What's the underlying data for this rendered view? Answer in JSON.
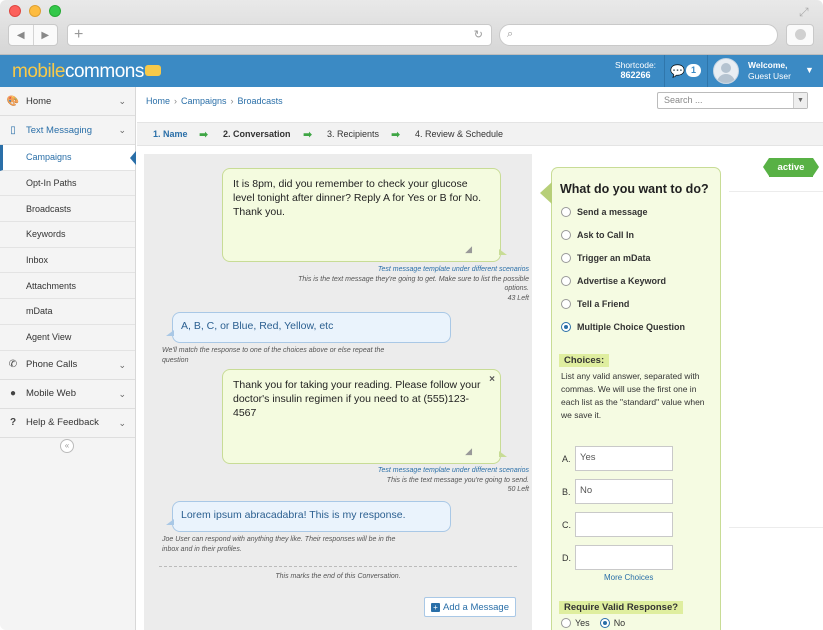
{
  "browser": {
    "back_icon": "◀",
    "forward_icon": "▶",
    "new_tab_icon": "+",
    "reload_icon": "↻",
    "search_icon": "⌕"
  },
  "header": {
    "logo_part1": "mobile",
    "logo_part2": "commons",
    "shortcode_label": "Shortcode:",
    "shortcode_value": "862266",
    "message_count": "1",
    "welcome_label": "Welcome,",
    "user_name": "Guest User",
    "colors": {
      "header_bg": "#3b8ac4",
      "logo_accent": "#f7c94a"
    }
  },
  "sidebar": {
    "items": [
      {
        "label": "Home",
        "icon": "palette-icon"
      },
      {
        "label": "Text Messaging",
        "icon": "phone-icon"
      },
      {
        "label": "Phone Calls",
        "icon": "phone-handset-icon"
      },
      {
        "label": "Mobile Web",
        "icon": "globe-icon"
      },
      {
        "label": "Help & Feedback",
        "icon": "question-icon"
      }
    ],
    "sub_items": [
      "Campaigns",
      "Opt-In Paths",
      "Broadcasts",
      "Keywords",
      "Inbox",
      "Attachments",
      "mData",
      "Agent View"
    ],
    "collapse_icon": "«"
  },
  "breadcrumb": {
    "items": [
      "Home",
      "Campaigns",
      "Broadcasts"
    ],
    "separator": "›"
  },
  "search": {
    "placeholder": "Search ..."
  },
  "wizard": {
    "steps": [
      "1. Name",
      "2. Conversation",
      "3. Recipients",
      "4. Review & Schedule"
    ],
    "arrow": "➡"
  },
  "conversation": {
    "message1": {
      "text": "It is 8pm, did you remember to check your glucose level tonight after dinner? Reply A for Yes or B for No. Thank you.",
      "link": "Test message template under different scenarios",
      "hint": "This is the text message they're going to get. Make sure to list the possible options.",
      "count": "43 Left"
    },
    "response1": {
      "text": "A, B, C, or Blue, Red, Yellow, etc",
      "hint": "We'll match the response to one of the choices above or else repeat the question"
    },
    "message2": {
      "text": "Thank you for taking your reading. Please follow your doctor's insulin regimen if you need to at (555)123-4567",
      "link": "Test message template under different scenarios",
      "hint": "This is the text message you're going to send.",
      "count": "50 Left",
      "close": "×"
    },
    "response2": {
      "text": "Lorem ipsum abracadabra! This is my response.",
      "hint": "Joe User can respond with anything they like. Their responses will be in the inbox and in their profiles."
    },
    "end_text": "This marks the end of this Conversation.",
    "add_button": "Add a Message"
  },
  "options": {
    "title": "What do you want to do?",
    "actions": [
      {
        "label": "Send a message",
        "selected": false
      },
      {
        "label": "Ask to Call In",
        "selected": false
      },
      {
        "label": "Trigger an mData",
        "selected": false
      },
      {
        "label": "Advertise a Keyword",
        "selected": false
      },
      {
        "label": "Tell a Friend",
        "selected": false
      },
      {
        "label": "Multiple Choice Question",
        "selected": true
      }
    ],
    "choices_heading": "Choices:",
    "choices_help": "List any valid answer, separated with commas. We will use the first one in each list as the \"standard\" value when we save it.",
    "choices": [
      {
        "label": "A.",
        "value": "Yes"
      },
      {
        "label": "B.",
        "value": "No"
      },
      {
        "label": "C.",
        "value": ""
      },
      {
        "label": "D.",
        "value": ""
      }
    ],
    "more_choices": "More Choices",
    "require_heading": "Require Valid Response?",
    "require_options": [
      {
        "label": "Yes",
        "selected": false
      },
      {
        "label": "No",
        "selected": true
      }
    ]
  },
  "status": {
    "label": "active",
    "color": "#58b145"
  }
}
